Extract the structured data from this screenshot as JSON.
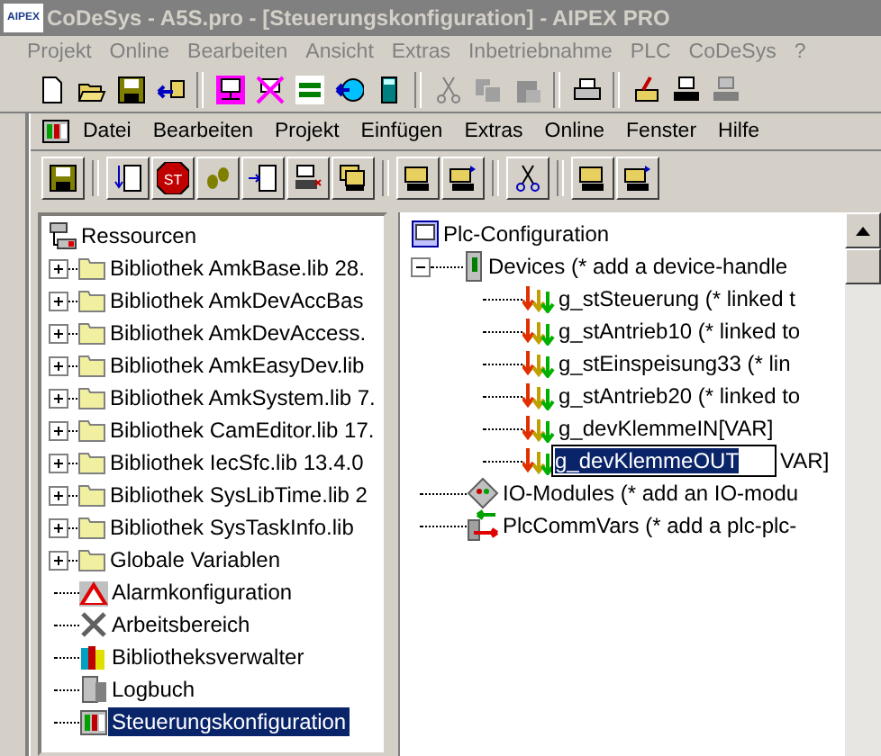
{
  "window": {
    "title": "CoDeSys - A5S.pro - [Steuerungskonfiguration] - AIPEX PRO",
    "logo": "AIPEX"
  },
  "menu": [
    "Projekt",
    "Online",
    "Bearbeiten",
    "Ansicht",
    "Extras",
    "Inbetriebnahme",
    "PLC",
    "CoDeSys",
    "?"
  ],
  "inner_menu": [
    "Datei",
    "Bearbeiten",
    "Projekt",
    "Einfügen",
    "Extras",
    "Online",
    "Fenster",
    "Hilfe"
  ],
  "inner_toolbar": {
    "stop_label": "ST"
  },
  "resources": {
    "label": "Ressourcen",
    "children": [
      {
        "kind": "folder",
        "label": "Bibliothek AmkBase.lib 28.",
        "expanded": false,
        "selected": false
      },
      {
        "kind": "folder",
        "label": "Bibliothek AmkDevAccBas",
        "expanded": false,
        "selected": false
      },
      {
        "kind": "folder",
        "label": "Bibliothek AmkDevAccess.",
        "expanded": false,
        "selected": false
      },
      {
        "kind": "folder",
        "label": "Bibliothek AmkEasyDev.lib",
        "expanded": false,
        "selected": false
      },
      {
        "kind": "folder",
        "label": "Bibliothek AmkSystem.lib 7.",
        "expanded": false,
        "selected": false
      },
      {
        "kind": "folder",
        "label": "Bibliothek CamEditor.lib 17.",
        "expanded": false,
        "selected": false
      },
      {
        "kind": "folder",
        "label": "Bibliothek IecSfc.lib 13.4.0",
        "expanded": false,
        "selected": false
      },
      {
        "kind": "folder",
        "label": "Bibliothek SysLibTime.lib 2",
        "expanded": false,
        "selected": false
      },
      {
        "kind": "folder",
        "label": "Bibliothek SysTaskInfo.lib",
        "expanded": false,
        "selected": false
      },
      {
        "kind": "folder",
        "label": "Globale Variablen",
        "expanded": false,
        "selected": false
      },
      {
        "kind": "alarm",
        "label": "Alarmkonfiguration",
        "selected": false
      },
      {
        "kind": "tools",
        "label": "Arbeitsbereich",
        "selected": false
      },
      {
        "kind": "books",
        "label": "Bibliotheksverwalter",
        "selected": false
      },
      {
        "kind": "log",
        "label": "Logbuch",
        "selected": false
      },
      {
        "kind": "config",
        "label": "Steuerungskonfiguration",
        "selected": true
      }
    ]
  },
  "configuration": {
    "label": "Plc-Configuration",
    "expanded": true,
    "children": [
      {
        "kind": "devices",
        "label": "Devices (* add a device-handle",
        "expanded": true,
        "children": [
          {
            "label": "g_stSteuerung (* linked t"
          },
          {
            "label": "g_stAntrieb10 (* linked to"
          },
          {
            "label": "g_stEinspeisung33 (* lin"
          },
          {
            "label": "g_stAntrieb20 (* linked to"
          },
          {
            "label": "g_devKlemmeIN[VAR]"
          },
          {
            "label": "VAR]",
            "edit_value": "g_devKlemmeOUT"
          }
        ]
      },
      {
        "kind": "modules",
        "label": "IO-Modules (* add an IO-modu"
      },
      {
        "kind": "comm",
        "label": "PlcCommVars (* add a plc-plc-"
      }
    ]
  }
}
